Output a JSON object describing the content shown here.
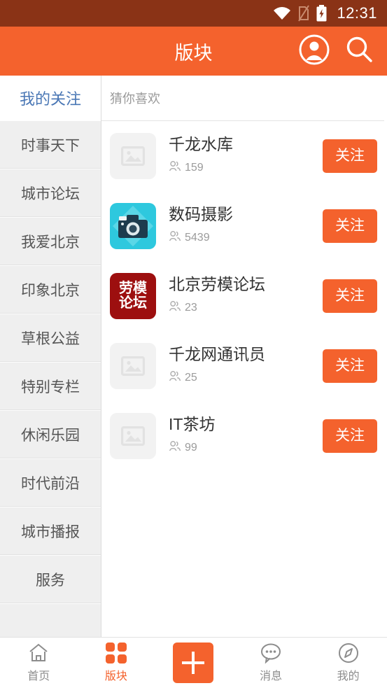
{
  "status_bar": {
    "time": "12:31",
    "icons": [
      "wifi-icon",
      "sim-off-icon",
      "battery-charging-icon"
    ],
    "background": "#8a3316"
  },
  "app_bar": {
    "title": "版块",
    "background": "#f4622d",
    "actions": [
      {
        "name": "account-icon",
        "label": "账户"
      },
      {
        "name": "search-icon",
        "label": "搜索"
      }
    ]
  },
  "sidebar": {
    "header_label": "我的关注",
    "header_color": "#4a77b5",
    "items": [
      {
        "label": "时事天下"
      },
      {
        "label": "城市论坛"
      },
      {
        "label": "我爱北京"
      },
      {
        "label": "印象北京"
      },
      {
        "label": "草根公益"
      },
      {
        "label": "特别专栏"
      },
      {
        "label": "休闲乐园"
      },
      {
        "label": "时代前沿"
      },
      {
        "label": "城市播报"
      },
      {
        "label": "服务"
      }
    ]
  },
  "main": {
    "header_label": "猜你喜欢",
    "follow_label": "关注",
    "accent": "#f4622d",
    "rows": [
      {
        "title": "千龙水库",
        "count": "159",
        "thumb": "placeholder-image-icon",
        "thumb_style": "placeholder"
      },
      {
        "title": "数码摄影",
        "count": "5439",
        "thumb": "camera-icon",
        "thumb_style": "camera"
      },
      {
        "title": "北京劳模论坛",
        "count": "23",
        "thumb": "laomo-forum-logo",
        "thumb_style": "laomo",
        "logo_line1": "劳模",
        "logo_line2": "论坛"
      },
      {
        "title": "千龙网通讯员",
        "count": "25",
        "thumb": "placeholder-image-icon",
        "thumb_style": "placeholder"
      },
      {
        "title": "IT茶坊",
        "count": "99",
        "thumb": "placeholder-image-icon",
        "thumb_style": "placeholder"
      }
    ]
  },
  "bottom_nav": {
    "active_color": "#f4622d",
    "inactive_color": "#8d8d8d",
    "items": [
      {
        "label": "首页",
        "icon": "home-icon",
        "active": false
      },
      {
        "label": "版块",
        "icon": "grid-icon",
        "active": true
      },
      {
        "label": "",
        "icon": "plus-icon",
        "active": false
      },
      {
        "label": "消息",
        "icon": "message-icon",
        "active": false
      },
      {
        "label": "我的",
        "icon": "compass-icon",
        "active": false
      }
    ]
  }
}
